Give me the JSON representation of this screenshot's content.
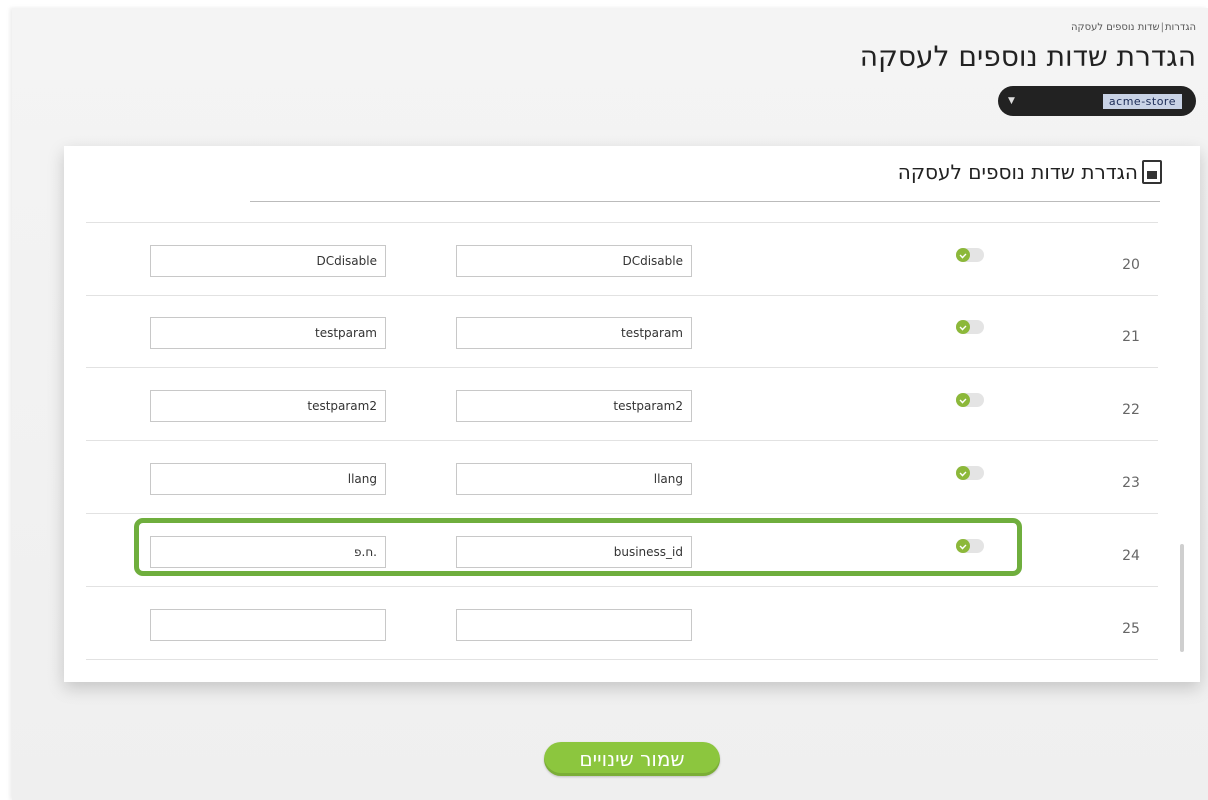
{
  "breadcrumb": {
    "parent": "הגדרות",
    "separator": "|",
    "current": "שדות נוספים לעסקה"
  },
  "page_title": "הגדרת שדות נוספים לעסקה",
  "account_select": {
    "value": "acme-store",
    "chevron_icon": "chevron-down-icon"
  },
  "card": {
    "title": "הגדרת שדות נוספים לעסקה",
    "icon": "document-icon"
  },
  "rows": [
    {
      "number": "20",
      "enabled": true,
      "field_name": "DCdisable",
      "field_label": "DCdisable"
    },
    {
      "number": "21",
      "enabled": true,
      "field_name": "testparam",
      "field_label": "testparam"
    },
    {
      "number": "22",
      "enabled": true,
      "field_name": "testparam2",
      "field_label": "testparam2"
    },
    {
      "number": "23",
      "enabled": true,
      "field_name": "llang",
      "field_label": "llang"
    },
    {
      "number": "24",
      "enabled": true,
      "field_name": "business_id",
      "field_label": "ח.פ."
    },
    {
      "number": "25",
      "enabled": null,
      "field_name": "",
      "field_label": ""
    }
  ],
  "save_button": {
    "label": "שמור שינויים"
  },
  "colors": {
    "accent_green": "#8cc63e",
    "highlight_green": "#6fae3d",
    "select_bg": "#222222"
  }
}
